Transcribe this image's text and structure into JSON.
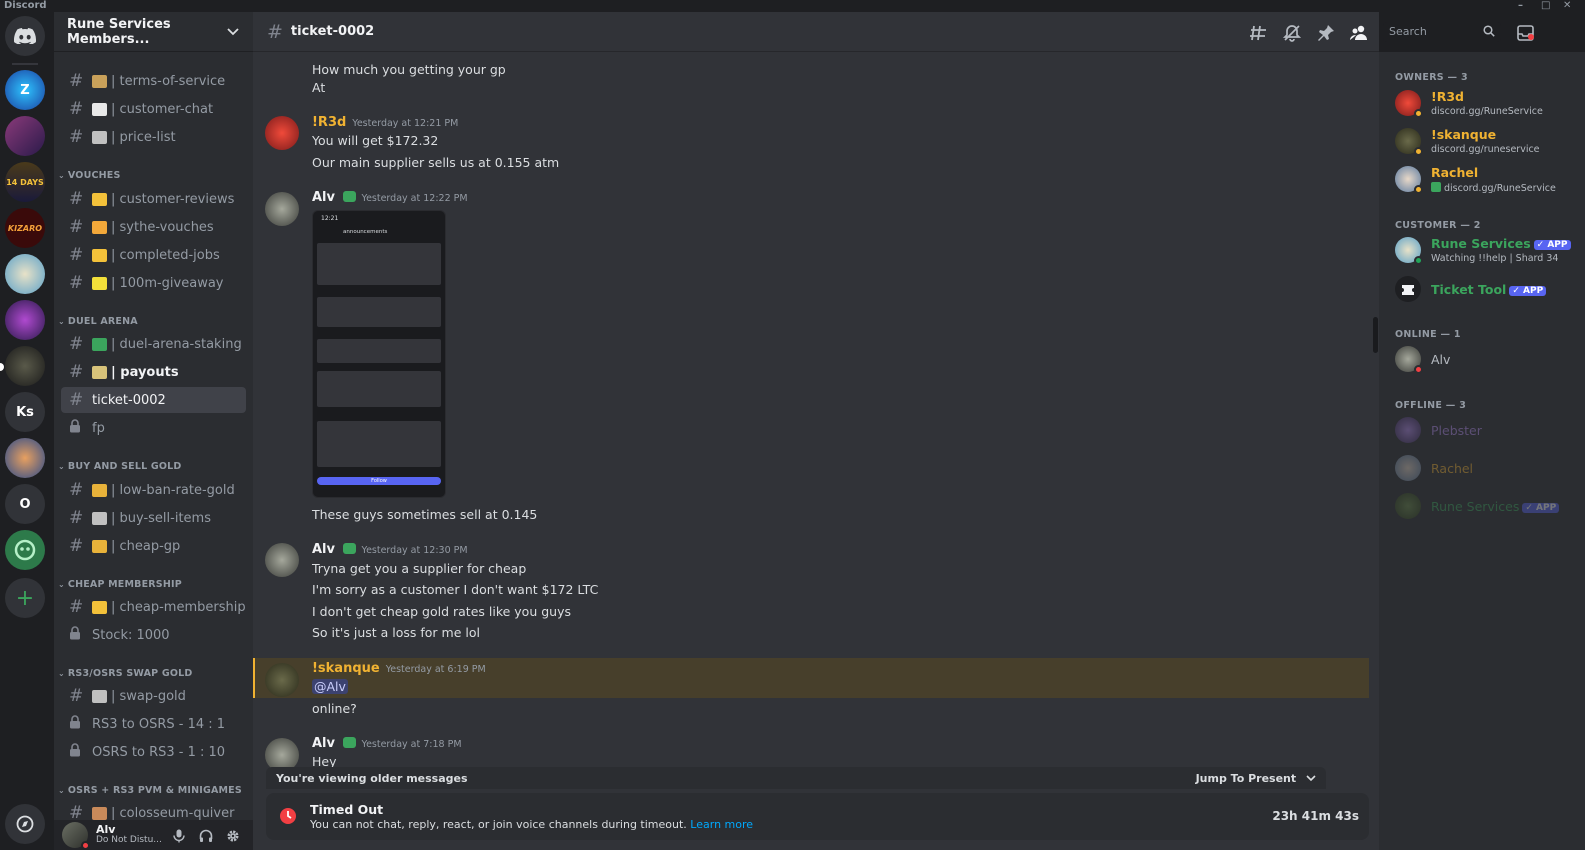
{
  "window": {
    "title": "Discord",
    "controls": [
      "–",
      "□",
      "✕"
    ]
  },
  "guilds": [
    {
      "label": "",
      "name": "discord-home",
      "color": "#313338"
    },
    {
      "label": "Z",
      "color": "#1b4fa8"
    },
    {
      "label": "",
      "color": "#5b2a5e"
    },
    {
      "label": "14 DAYS",
      "color": "#3a2b1a"
    },
    {
      "label": "KIZARO",
      "color": "#5a1010"
    },
    {
      "label": "",
      "color": "#6aa0c8"
    },
    {
      "label": "",
      "color": "#4a2a6a"
    },
    {
      "label": "",
      "color": "#2a2a2a"
    },
    {
      "label": "Ks",
      "color": "#313338"
    },
    {
      "label": "",
      "color": "#3a5a8a"
    },
    {
      "label": "O",
      "color": "#313338"
    },
    {
      "label": "",
      "color": "#2d7a4a"
    },
    {
      "label": "+",
      "color": "#313338"
    }
  ],
  "server": {
    "name": "Rune Services Members...",
    "chevron": "⌄"
  },
  "channels": {
    "top": [
      {
        "emoji": "📜",
        "name": "| terms-of-service",
        "color": "#c9a15a"
      },
      {
        "emoji": "💬",
        "name": "| customer-chat",
        "color": "#e8e8e8"
      },
      {
        "emoji": "🛒",
        "name": "| price-list",
        "color": "#c0c0c0"
      }
    ],
    "cat_vouches": "VOUCHES",
    "vouches": [
      {
        "emoji": "💛",
        "name": "| customer-reviews",
        "color": "#f3c13a"
      },
      {
        "emoji": "🏆",
        "name": "| sythe-vouches",
        "color": "#f3a83a"
      },
      {
        "emoji": "👍",
        "name": "| completed-jobs",
        "color": "#f3c13a"
      },
      {
        "emoji": "✨",
        "name": "| 100m-giveaway",
        "color": "#f3e03a"
      }
    ],
    "cat_duel": "DUEL ARENA",
    "duel": [
      {
        "emoji": "$",
        "name": "| duel-arena-staking",
        "color": "#3ba55d"
      },
      {
        "emoji": "💸",
        "name": "| payouts",
        "color": "#d8c37a"
      },
      {
        "emoji": "",
        "name": "ticket-0002"
      },
      {
        "emoji": "",
        "name": "fp",
        "locked": true
      }
    ],
    "cat_buy": "BUY AND SELL GOLD",
    "buy": [
      {
        "emoji": "💰",
        "name": "| low-ban-rate-gold",
        "color": "#e8b23a"
      },
      {
        "emoji": "🛒",
        "name": "| buy-sell-items",
        "color": "#c0c0c0"
      },
      {
        "emoji": "💰",
        "name": "| cheap-gp",
        "color": "#e8b23a"
      }
    ],
    "cat_cheap": "CHEAP MEMBERSHIP",
    "cheap": [
      {
        "emoji": "👑",
        "name": "| cheap-membership",
        "color": "#f3c13a"
      },
      {
        "name": "Stock: 1000",
        "locked": true
      }
    ],
    "cat_swap": "RS3/OSRS SWAP GOLD",
    "swap": [
      {
        "emoji": "🔁",
        "name": "| swap-gold",
        "color": "#c0c0c0"
      },
      {
        "name": "RS3 to OSRS - 14 : 1",
        "locked": true
      },
      {
        "name": "OSRS to RS3 - 1 : 10",
        "locked": true
      }
    ],
    "cat_pvm": "OSRS + RS3 PVM & MINIGAMES",
    "pvm": [
      {
        "emoji": "🏹",
        "name": "| colosseum-quiver",
        "color": "#c98a5a"
      }
    ]
  },
  "user": {
    "name": "Alv",
    "status": "Do Not Distu..."
  },
  "topbar": {
    "channel": "ticket-0002",
    "search_placeholder": "Search"
  },
  "messages": {
    "cont1": [
      "How much you getting your gp",
      "At"
    ],
    "m1": {
      "author": "!R3d",
      "color": "#f0b232",
      "time": "Yesterday at 12:21 PM",
      "lines": [
        "You will get $172.32",
        "Our main supplier sells us at 0.155 atm"
      ]
    },
    "m2": {
      "author": "Alv",
      "color": "#f2f3f5",
      "time": "Yesterday at 12:22 PM",
      "lines": [
        "These guys sometimes sell at 0.145"
      ]
    },
    "m3": {
      "author": "Alv",
      "color": "#f2f3f5",
      "time": "Yesterday at 12:30 PM",
      "lines": [
        "Tryna get you a supplier for cheap",
        "I'm sorry as a customer I don't want $172 LTC",
        "I don't get cheap gold rates like you guys",
        "So it's just a loss for me lol"
      ]
    },
    "m4": {
      "author": "!skanque",
      "color": "#f0b232",
      "time": "Yesterday at 6:19 PM",
      "mention": "@Alv",
      "lines": [
        "online?"
      ]
    },
    "m5": {
      "author": "Alv",
      "color": "#f2f3f5",
      "time": "Yesterday at 7:18 PM",
      "lines": [
        "Hey"
      ]
    }
  },
  "screenshot": {
    "time": "12:21",
    "channel": "announcements",
    "follow": "Follow"
  },
  "older_bar": {
    "text": "You're viewing older messages",
    "jump": "Jump To Present"
  },
  "timeout": {
    "title": "Timed Out",
    "desc": "You can not chat, reply, react, or join voice channels during timeout.",
    "link": "Learn more",
    "remaining": "23h 41m 43s"
  },
  "members": {
    "owners_label": "OWNERS — 3",
    "owners": [
      {
        "name": "!R3d",
        "sub": "discord.gg/RuneService",
        "color": "#f0b232"
      },
      {
        "name": "!skanque",
        "sub": "discord.gg/runeservice",
        "color": "#f0b232"
      },
      {
        "name": "Rachel",
        "sub": "discord.gg/RuneService",
        "color": "#f0b232"
      }
    ],
    "customer_label": "CUSTOMER — 2",
    "customers": [
      {
        "name": "Rune Services",
        "badge": "✓ APP",
        "sub": "Watching !!help | Shard 34",
        "color": "#3ba55d"
      },
      {
        "name": "Ticket Tool",
        "badge": "✓ APP",
        "sub": "",
        "color": "#3ba55d"
      }
    ],
    "online_label": "ONLINE — 1",
    "online": [
      {
        "name": "Alv",
        "color": "#b5bac1"
      }
    ],
    "offline_label": "OFFLINE — 3",
    "offline": [
      {
        "name": "Plebster",
        "color": "#b58cf0"
      },
      {
        "name": "Rachel",
        "color": "#f0b232"
      },
      {
        "name": "Rune Services",
        "badge": "✓ APP",
        "color": "#3ba55d"
      }
    ]
  }
}
